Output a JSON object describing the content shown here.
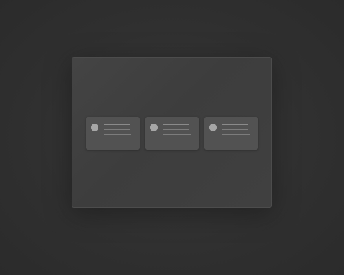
{
  "colors": {
    "background": "#313131",
    "panel": "#414141",
    "card": "#525252",
    "avatar": "#a6a6a6",
    "text_line": "#8a8a8a"
  },
  "cards": [
    {
      "avatar_icon": "avatar-placeholder-icon",
      "text_lines": 3
    },
    {
      "avatar_icon": "avatar-placeholder-icon",
      "text_lines": 3
    },
    {
      "avatar_icon": "avatar-placeholder-icon",
      "text_lines": 3
    }
  ]
}
